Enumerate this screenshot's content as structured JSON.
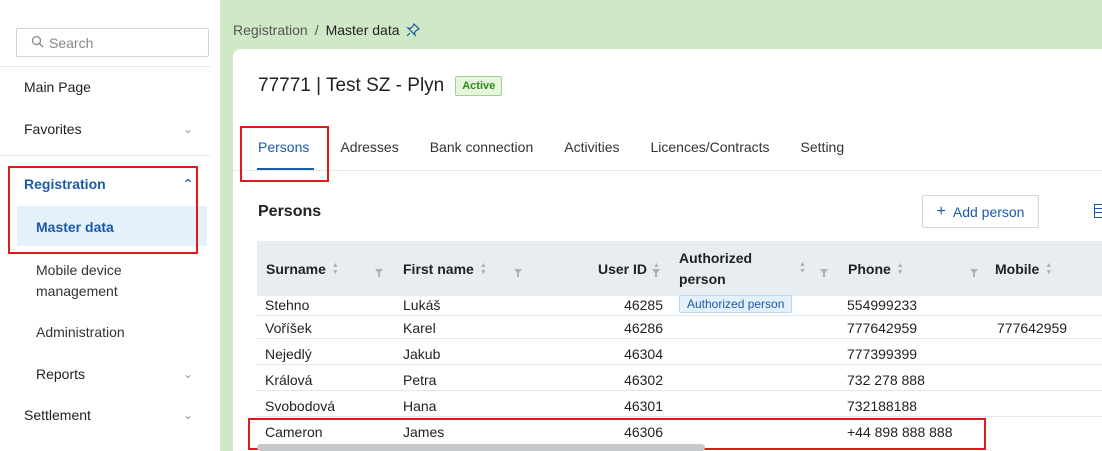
{
  "sidebar": {
    "search_placeholder": "Search",
    "items": {
      "main_page": "Main Page",
      "favorites": "Favorites",
      "registration": "Registration",
      "master_data": "Master data",
      "mobile_device": "Mobile device management",
      "administration": "Administration",
      "reports": "Reports",
      "settlement": "Settlement"
    }
  },
  "breadcrumb": {
    "parent": "Registration",
    "separator": "/",
    "current": "Master data"
  },
  "header": {
    "title": "77771 | Test SZ - Plyn",
    "status": "Active"
  },
  "tabs": [
    "Persons",
    "Adresses",
    "Bank connection",
    "Activities",
    "Licences/Contracts",
    "Setting"
  ],
  "section": {
    "title": "Persons",
    "add_button": "Add person"
  },
  "table": {
    "columns": {
      "surname": "Surname",
      "first_name": "First name",
      "user_id": "User ID",
      "authorized": "Authorized person",
      "phone": "Phone",
      "mobile": "Mobile"
    },
    "rows": [
      {
        "surname": "Stehno",
        "first_name": "Lukáš",
        "user_id": "46285",
        "authorized": "Authorized person",
        "phone": "554999233",
        "mobile": ""
      },
      {
        "surname": "Voříšek",
        "first_name": "Karel",
        "user_id": "46286",
        "authorized": "",
        "phone": "777642959",
        "mobile": "777642959"
      },
      {
        "surname": "Nejedlý",
        "first_name": "Jakub",
        "user_id": "46304",
        "authorized": "",
        "phone": "777399399",
        "mobile": ""
      },
      {
        "surname": "Králová",
        "first_name": "Petra",
        "user_id": "46302",
        "authorized": "",
        "phone": "732 278 888",
        "mobile": ""
      },
      {
        "surname": "Svobodová",
        "first_name": "Hana",
        "user_id": "46301",
        "authorized": "",
        "phone": "732188188",
        "mobile": ""
      },
      {
        "surname": "Cameron",
        "first_name": "James",
        "user_id": "46306",
        "authorized": "",
        "phone": "+44 898 888 888",
        "mobile": ""
      }
    ]
  },
  "colors": {
    "accent": "#1a5aa6",
    "highlight": "#e01919",
    "band": "#cfe8c6",
    "active_badge": "#2e8a1e"
  }
}
